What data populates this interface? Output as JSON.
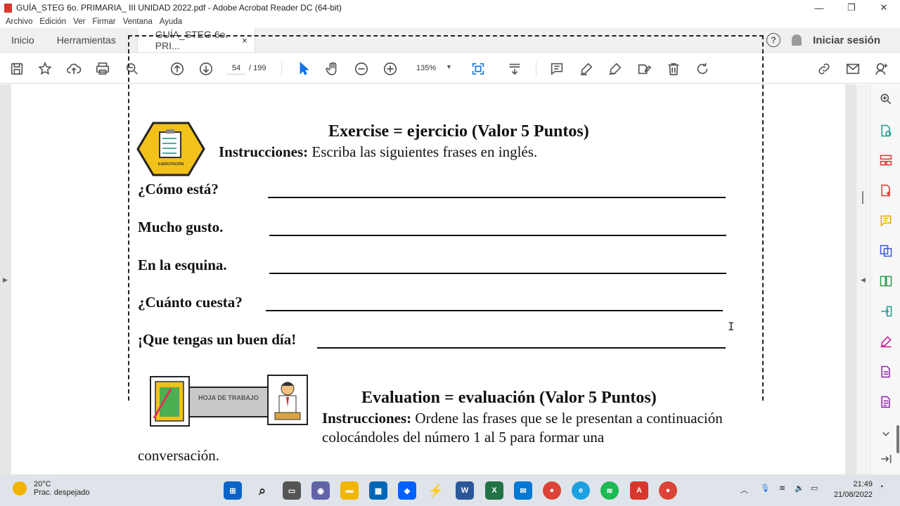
{
  "window": {
    "title": "GUÍA_STEG 6o. PRIMARIA_ III UNIDAD 2022.pdf - Adobe Acrobat Reader DC (64-bit)",
    "minimize": "—",
    "maximize": "❐",
    "close": "✕"
  },
  "menu": [
    "Archivo",
    "Edición",
    "Ver",
    "Firmar",
    "Ventana",
    "Ayuda"
  ],
  "tabs": {
    "home": "Inicio",
    "tools": "Herramientas",
    "document": "GUÍA_STEG 6o. PRI...",
    "document_close": "×",
    "help": "?",
    "signin": "Iniciar sesión"
  },
  "toolbar": {
    "page_current": "54",
    "page_total": "/ 199",
    "zoom": "135%"
  },
  "document": {
    "exercise_title": "Exercise = ejercicio (Valor 5 Puntos)",
    "exercise_instr_label": "Instrucciones:",
    "exercise_instr_text": " Escriba las siguientes frases en inglés.",
    "phrases": [
      "¿Cómo está?",
      "Mucho gusto.",
      "En la esquina.",
      "¿Cuánto cuesta?",
      "¡Que tengas un buen día!"
    ],
    "badge_text": "EJERCITACIÓN",
    "worksheet_label": "HOJA DE TRABAJO",
    "evaluation_title": "Evaluation = evaluación (Valor 5 Puntos)",
    "evaluation_instr_label": "Instrucciones:",
    "evaluation_instr_text": " Ordene las frases que se le presentan a continuación colocándoles del número 1 al 5 para formar una",
    "evaluation_tail": "conversación."
  },
  "taskbar": {
    "temp": "20°C",
    "weather": "Prac. despejado",
    "time": "21:49",
    "date": "21/08/2022"
  },
  "colors": {
    "acrobat_red": "#d9372b",
    "badge_yellow": "#f2c21b",
    "toolbar_blue": "#1473e6"
  }
}
